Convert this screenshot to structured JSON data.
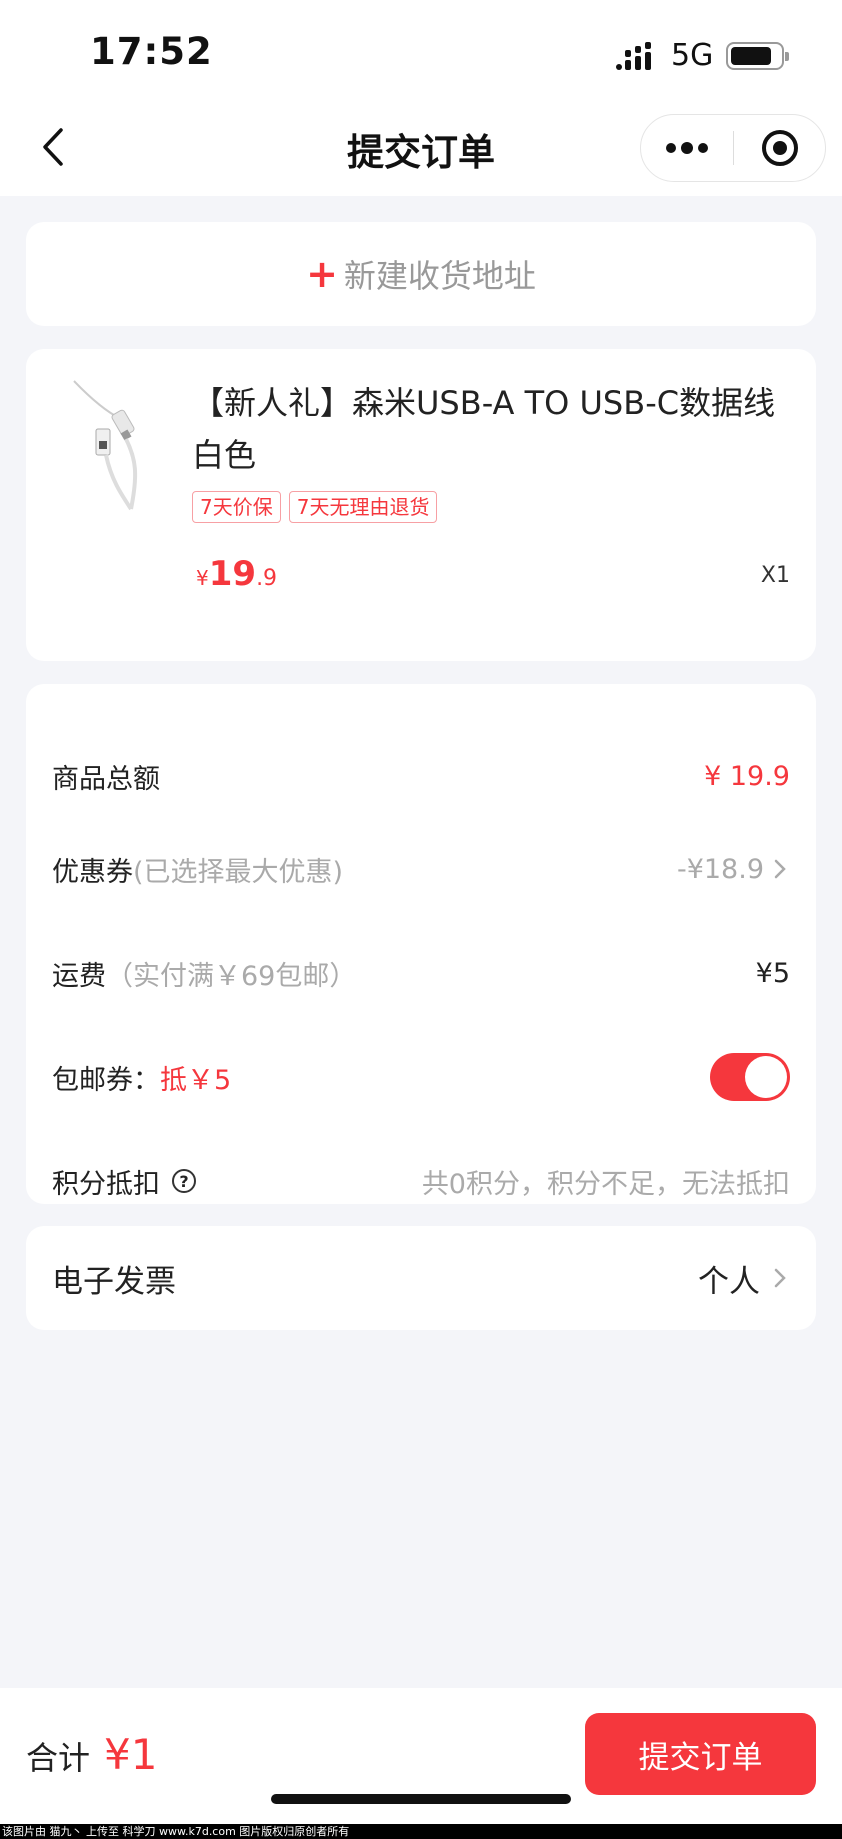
{
  "status_bar": {
    "time": "17:52",
    "network": "5G"
  },
  "nav": {
    "title": "提交订单"
  },
  "address": {
    "plus": "+",
    "label": "新建收货地址"
  },
  "product": {
    "title": "【新人礼】森米USB-A TO USB-C数据线 白色",
    "tags": [
      "7天价保",
      "7天无理由退货"
    ],
    "price": {
      "currency": "¥",
      "integer": "19",
      "decimal": ".9"
    },
    "quantity": "X1"
  },
  "summary": {
    "goods_total": {
      "label": "商品总额",
      "value": "¥ 19.9"
    },
    "coupon": {
      "label": "优惠券",
      "note": "(已选择最大优惠)",
      "value": "-¥18.9"
    },
    "shipping": {
      "label": "运费",
      "note": "（实付满￥69包邮）",
      "value": "¥5"
    },
    "free_ship_coupon": {
      "label": "包邮券：",
      "note": "抵￥5",
      "enabled": true
    },
    "points": {
      "label": "积分抵扣",
      "help": "?",
      "value": "共0积分，积分不足，无法抵扣"
    }
  },
  "invoice": {
    "label": "电子发票",
    "value": "个人"
  },
  "footer": {
    "total_label": "合计",
    "total_value": "¥1",
    "submit_label": "提交订单"
  },
  "watermark": "该图片由 猫九丶 上传至 科学刀 www.k7d.com 图片版权归原创者所有",
  "colors": {
    "accent": "#f5373d",
    "background": "#f4f5f9"
  }
}
